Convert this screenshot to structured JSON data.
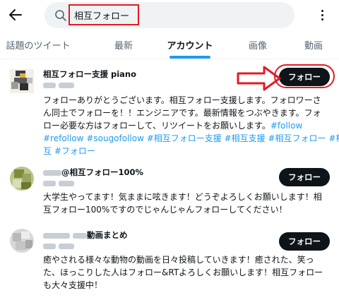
{
  "search": {
    "query": "相互フォロー"
  },
  "tabs": [
    {
      "label": "話題のツイート"
    },
    {
      "label": "最新"
    },
    {
      "label": "アカウント",
      "active": true
    },
    {
      "label": "画像"
    },
    {
      "label": "動画"
    }
  ],
  "accounts": [
    {
      "name": "相互フォロー支援 piano",
      "follow_label": "フォロー",
      "bio_lines": [
        [
          {
            "t": "フォローありがとうございます。相互フォロー支援します。フォロワーさ"
          }
        ],
        [
          {
            "t": "ん同士でフォローを！！エンジニアです。最新情報をつぶやきます。フォ"
          }
        ],
        [
          {
            "t": "ロー必要な方はフォローして、リツイートをお願いします。"
          },
          {
            "t": "#follow",
            "tag": true
          }
        ],
        [
          {
            "t": "#refollow #sougofollow #相互フォロー支援 #相互支援 #相互フォロー #相",
            "tag": true
          }
        ],
        [
          {
            "t": "互 #フォロー",
            "tag": true
          }
        ]
      ]
    },
    {
      "name": "@相互フォロー100%",
      "follow_label": "フォロー",
      "bio_lines": [
        [
          {
            "t": "大学生やってます！気ままに呟きます！どうぞよろしくお願いします！相"
          }
        ],
        [
          {
            "t": "互フォロー100%ですのでじゃんじゃんフォローしてください！"
          }
        ]
      ]
    },
    {
      "name": "動画まとめ",
      "follow_label": "フォロー",
      "bio_lines": [
        [
          {
            "t": "癒やされる様々な動物の動画を日々投稿していきます！癒された、笑っ"
          }
        ],
        [
          {
            "t": "た、ほっこりした人はフォロー&RTよろしくお願いします！相互フォロー"
          }
        ],
        [
          {
            "t": "も大々支援中！"
          }
        ]
      ]
    }
  ],
  "colors": {
    "accent": "#1d9bf0",
    "annotation": "#e01b24",
    "button": "#0f1419"
  }
}
